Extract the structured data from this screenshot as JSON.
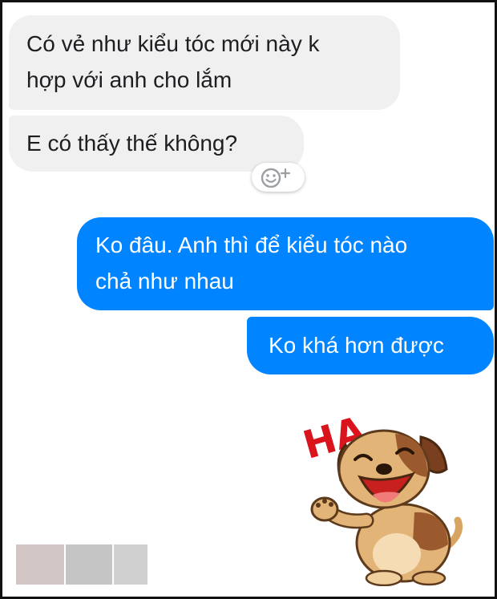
{
  "conversation": {
    "messages": [
      {
        "sender": "other",
        "lines": [
          "Có vẻ như kiểu tóc mới này k",
          "hợp với anh cho lắm"
        ]
      },
      {
        "sender": "other",
        "lines": [
          "E có thấy thế không?"
        ]
      },
      {
        "sender": "me",
        "lines": [
          "Ko đâu. Anh thì để kiểu tóc nào",
          "chả như nhau"
        ]
      },
      {
        "sender": "me",
        "lines": [
          "Ko khá hơn được"
        ]
      }
    ],
    "reaction_button_icon": "smiley-plus-icon",
    "sticker": {
      "icon": "laughing-dog-sticker",
      "text": "HA"
    },
    "redacted_name_blocks": [
      "#d2c7c4",
      "#c5c5c5",
      "#d0d0d0"
    ]
  },
  "colors": {
    "incoming_bubble": "#f1f0f0",
    "outgoing_bubble": "#0084ff",
    "sticker_ha_text": "#d9141c",
    "frame_border": "#111111"
  }
}
